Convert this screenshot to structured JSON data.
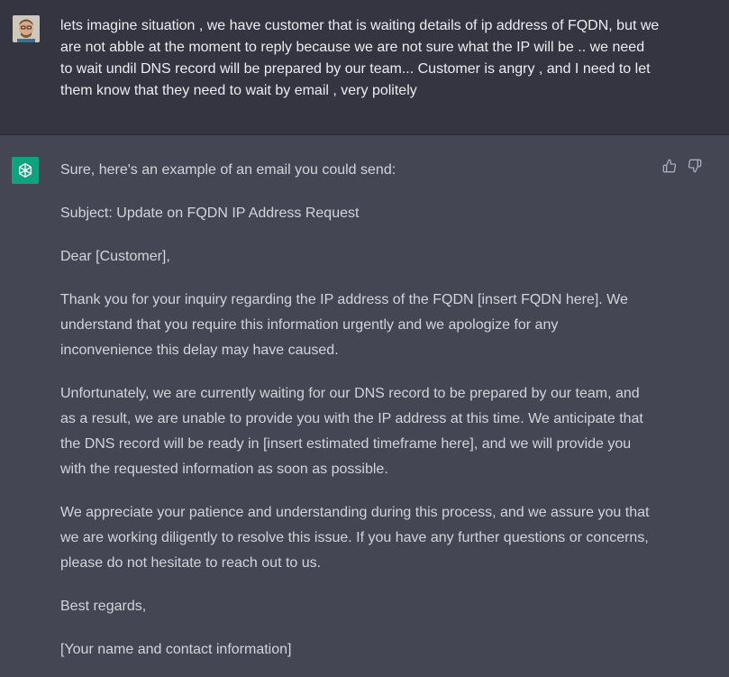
{
  "user_message": {
    "text": "lets imagine situation , we have customer that is waiting details of ip address of FQDN, but we are not abble at the moment to reply because we are not sure what the IP will be .. we need to wait undil DNS record will be prepared by our team... Customer is angry , and I need to let them know that they need to wait by email , very politely"
  },
  "assistant_message": {
    "paragraphs": [
      "Sure, here's an example of an email you could send:",
      "Subject: Update on FQDN IP Address Request",
      "Dear [Customer],",
      "Thank you for your inquiry regarding the IP address of the FQDN [insert FQDN here]. We understand that you require this information urgently and we apologize for any inconvenience this delay may have caused.",
      "Unfortunately, we are currently waiting for our DNS record to be prepared by our team, and as a result, we are unable to provide you with the IP address at this time. We anticipate that the DNS record will be ready in [insert estimated timeframe here], and we will provide you with the requested information as soon as possible.",
      "We appreciate your patience and understanding during this process, and we assure you that we are working diligently to resolve this issue. If you have any further questions or concerns, please do not hesitate to reach out to us.",
      "Best regards,",
      "[Your name and contact information]"
    ]
  },
  "icons": {
    "user_avatar": "user-avatar",
    "bot_avatar": "openai-logo-icon",
    "thumbs_up": "thumbs-up-icon",
    "thumbs_down": "thumbs-down-icon"
  },
  "colors": {
    "user_bg": "#343541",
    "assistant_bg": "#444654",
    "bot_avatar_bg": "#10a37f",
    "text": "#d1d5db"
  }
}
